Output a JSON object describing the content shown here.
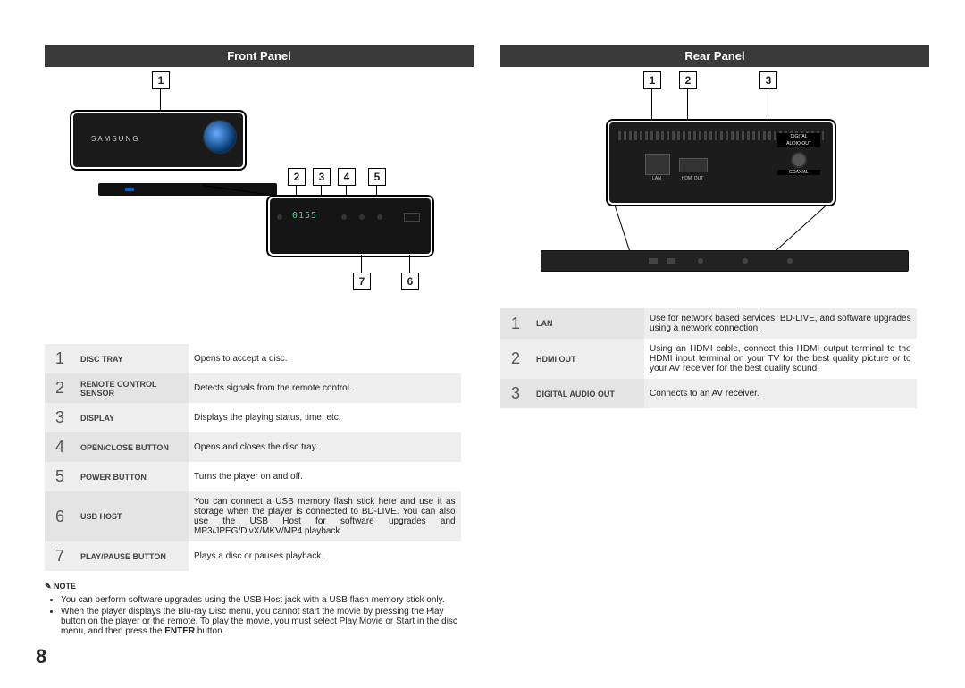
{
  "page_number": "8",
  "left": {
    "header": "Front Panel",
    "callouts": [
      "1",
      "2",
      "3",
      "4",
      "5",
      "6",
      "7"
    ],
    "device_brand": "SAMSUNG",
    "display_text": "0155",
    "table": [
      {
        "num": "1",
        "label": "DISC TRAY",
        "desc": "Opens to accept a disc."
      },
      {
        "num": "2",
        "label": "REMOTE CONTROL SENSOR",
        "desc": "Detects signals from the remote control."
      },
      {
        "num": "3",
        "label": "DISPLAY",
        "desc": "Displays the playing status, time, etc."
      },
      {
        "num": "4",
        "label": "OPEN/CLOSE BUTTON",
        "desc": "Opens and closes the disc tray."
      },
      {
        "num": "5",
        "label": "POWER BUTTON",
        "desc": "Turns the player on and off."
      },
      {
        "num": "6",
        "label": "USB HOST",
        "desc": "You can connect a USB memory flash stick here and use it as storage when the player is connected to BD-LIVE. You can also use the USB Host for software upgrades and MP3/JPEG/DivX/MKV/MP4 playback."
      },
      {
        "num": "7",
        "label": "PLAY/PAUSE BUTTON",
        "desc": "Plays a disc or pauses playback."
      }
    ],
    "note_title": "NOTE",
    "notes": [
      "You can perform software upgrades using the USB Host jack with a USB flash memory stick only.",
      "When the player displays the Blu-ray Disc menu, you cannot start the movie by pressing the Play button on the player or the remote. To play the movie, you must select Play Movie or Start in the disc menu, and then press the ENTER button."
    ]
  },
  "right": {
    "header": "Rear Panel",
    "callouts": [
      "1",
      "2",
      "3"
    ],
    "port_labels": {
      "lan": "LAN",
      "hdmi": "HDMI OUT",
      "audio1": "DIGITAL",
      "audio2": "AUDIO OUT",
      "coax": "COAXIAL"
    },
    "table": [
      {
        "num": "1",
        "label": "LAN",
        "desc": "Use for network based services, BD-LIVE, and software upgrades using a network connection."
      },
      {
        "num": "2",
        "label": "HDMI OUT",
        "desc": "Using an HDMI cable, connect this HDMI output terminal to the HDMI input terminal on your TV for the best quality picture or to your AV receiver for the best quality sound."
      },
      {
        "num": "3",
        "label": "DIGITAL AUDIO OUT",
        "desc": "Connects to an AV receiver."
      }
    ]
  }
}
